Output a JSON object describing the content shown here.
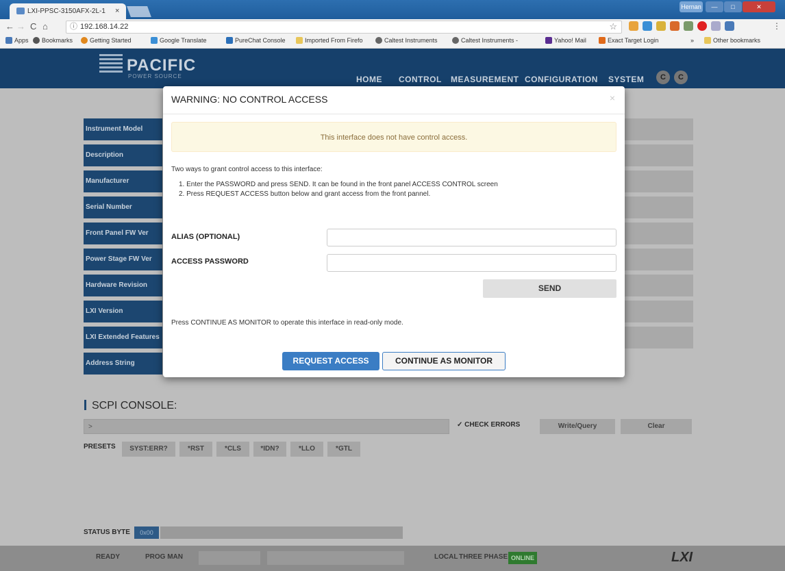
{
  "browser": {
    "tab_title": "LXI-PPSC-3150AFX-2L-1",
    "tab_close": "×",
    "window_user": "Hernan",
    "address": "192.168.14.22",
    "bookmarks": [
      "Apps",
      "Bookmarks",
      "Getting Started",
      "Google Translate",
      "PureChat Console",
      "Imported From Firefo",
      "Caltest Instruments",
      "Caltest Instruments -",
      "Yahoo! Mail",
      "Exact Target Login",
      "»",
      "Other bookmarks"
    ]
  },
  "site": {
    "logo": "PACIFIC",
    "logo_sub": "POWER SOURCE",
    "menu": [
      "HOME",
      "CONTROL",
      "MEASUREMENT",
      "CONFIGURATION",
      "SYSTEM"
    ],
    "circle_buttons": [
      "C",
      "C"
    ],
    "info_items": [
      "Instrument Model",
      "Description",
      "Manufacturer",
      "Serial Number",
      "Front Panel FW Ver",
      "Power Stage FW Ver",
      "Hardware Revision",
      "LXI Version",
      "LXI Extended Features",
      "Address String"
    ],
    "scpi_title": "SCPI CONSOLE:",
    "scpi_placeholder": ">",
    "check_errors": "✓ CHECK ERRORS",
    "write_query": "Write/Query",
    "clear": "Clear",
    "presets_label": "PRESETS",
    "presets": [
      "SYST:ERR?",
      "*RST",
      "*CLS",
      "*IDN?",
      "*LLO",
      "*GTL"
    ],
    "status_byte_label": "STATUS BYTE",
    "status_byte_value": "0x00",
    "footer": {
      "ready": "READY",
      "prog_man": "PROG MAN",
      "local": "LOCAL",
      "phase": "THREE PHASE",
      "online": "ONLINE",
      "lxi": "LXI"
    }
  },
  "modal": {
    "title": "WARNING: NO CONTROL ACCESS",
    "close": "×",
    "alert": "This interface does not have control access.",
    "intro": "Two ways to grant control access to this interface:",
    "step1": "1. Enter the PASSWORD and press SEND. It can be found in the front panel ACCESS CONTROL screen",
    "step2": "2. Press REQUEST ACCESS button below and grant access from the front pannel.",
    "alias_label": "ALIAS (OPTIONAL)",
    "password_label": "ACCESS PASSWORD",
    "send": "SEND",
    "monitor_note": "Press CONTINUE AS MONITOR to operate this interface in read-only mode.",
    "request_access": "REQUEST ACCESS",
    "continue_monitor": "CONTINUE AS MONITOR"
  },
  "colors": {
    "header_blue": "#16406b",
    "modal_primary": "#3b7dc4",
    "alert_bg": "#fcf8e3",
    "online_green": "#2f7a2f"
  }
}
